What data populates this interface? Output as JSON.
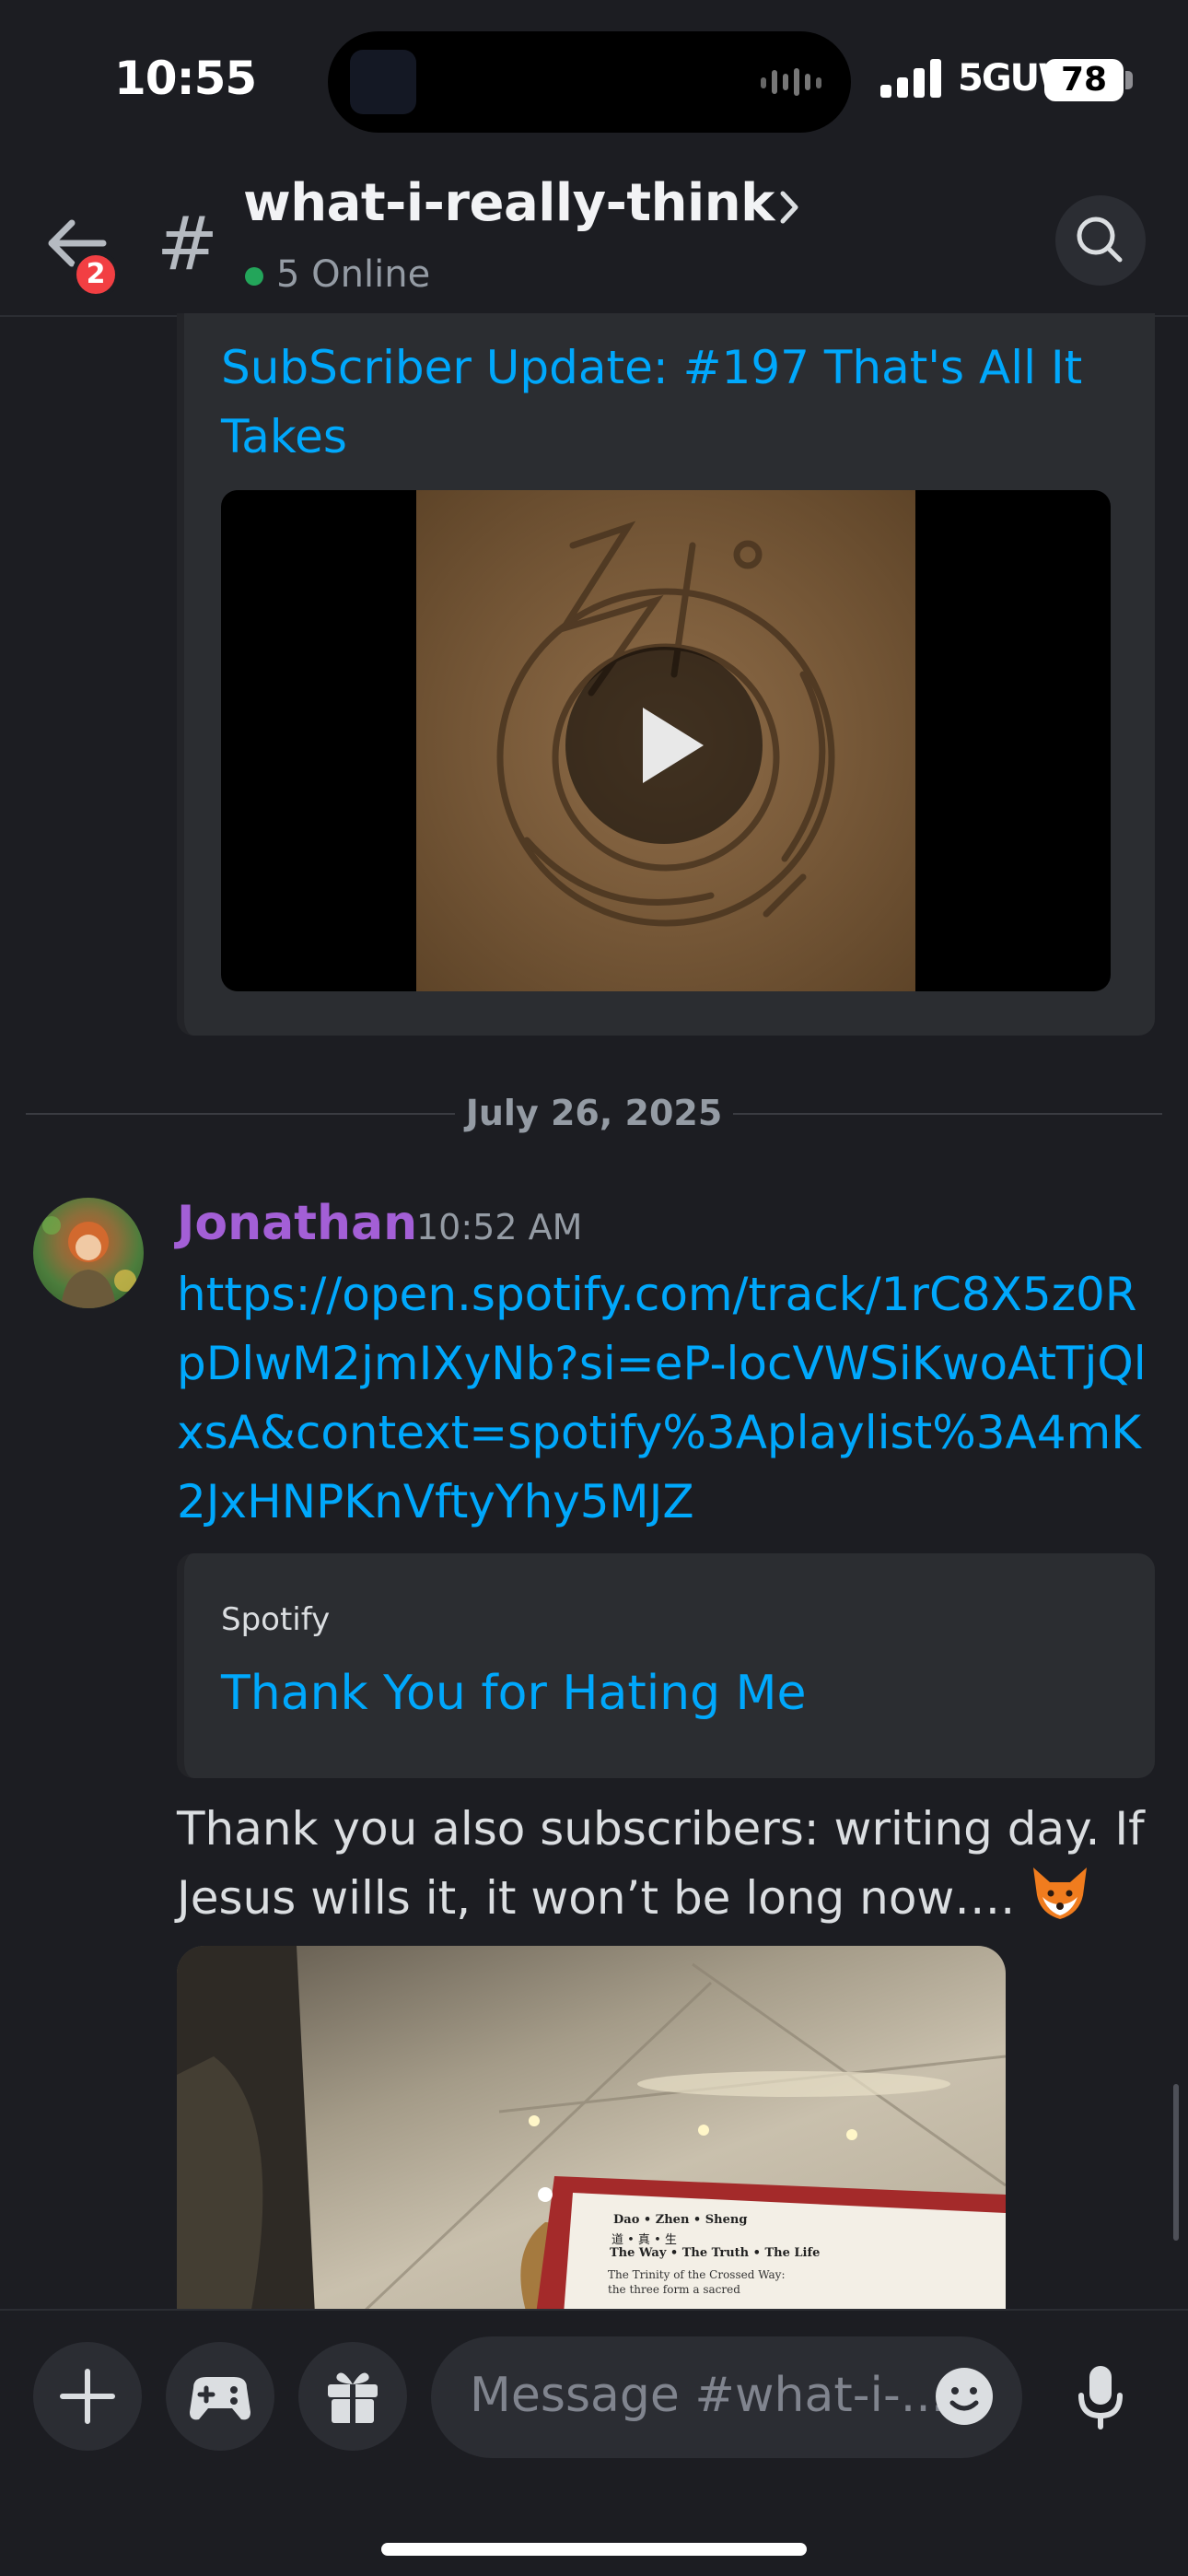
{
  "status_bar": {
    "time": "10:55",
    "network": "5GUW",
    "battery": "78"
  },
  "header": {
    "back_badge": "2",
    "hash_symbol": "#",
    "channel_name": "what-i-really-think",
    "online_status": "5 Online"
  },
  "messages": {
    "prev_embed": {
      "title": "SubScriber Update: #197 That's All It Takes"
    },
    "date_divider": "July 26, 2025",
    "current": {
      "author": "Jonathan",
      "timestamp": "10:52 AM",
      "link": "https://open.spotify.com/track/1rC8X5z0RpDlwM2jmIXyNb?si=eP-locVWSiKwoAtTjQlxsA&context=spotify%3Aplaylist%3A4mK2JxHNPKnVftyYhy5MJZ",
      "embed": {
        "provider": "Spotify",
        "title": "Thank You for Hating Me"
      },
      "text": "Thank you also subscribers: writing day. If Jesus wills it, it won’t be long now…. ",
      "photo_text": {
        "line1": "Dao • Zhen • Sheng",
        "line2": "道 • 真 • 生",
        "line3": "The Way • The Truth • The Life",
        "line4": "The Trinity of the Crossed Way:",
        "line5": "the three form a sacred"
      }
    }
  },
  "composer": {
    "placeholder": "Message #what-i-..."
  },
  "colors": {
    "background": "#1c1d22",
    "link": "#00a8fc",
    "author": "#a35fd6",
    "badge": "#f23f43",
    "online": "#23a55a"
  }
}
